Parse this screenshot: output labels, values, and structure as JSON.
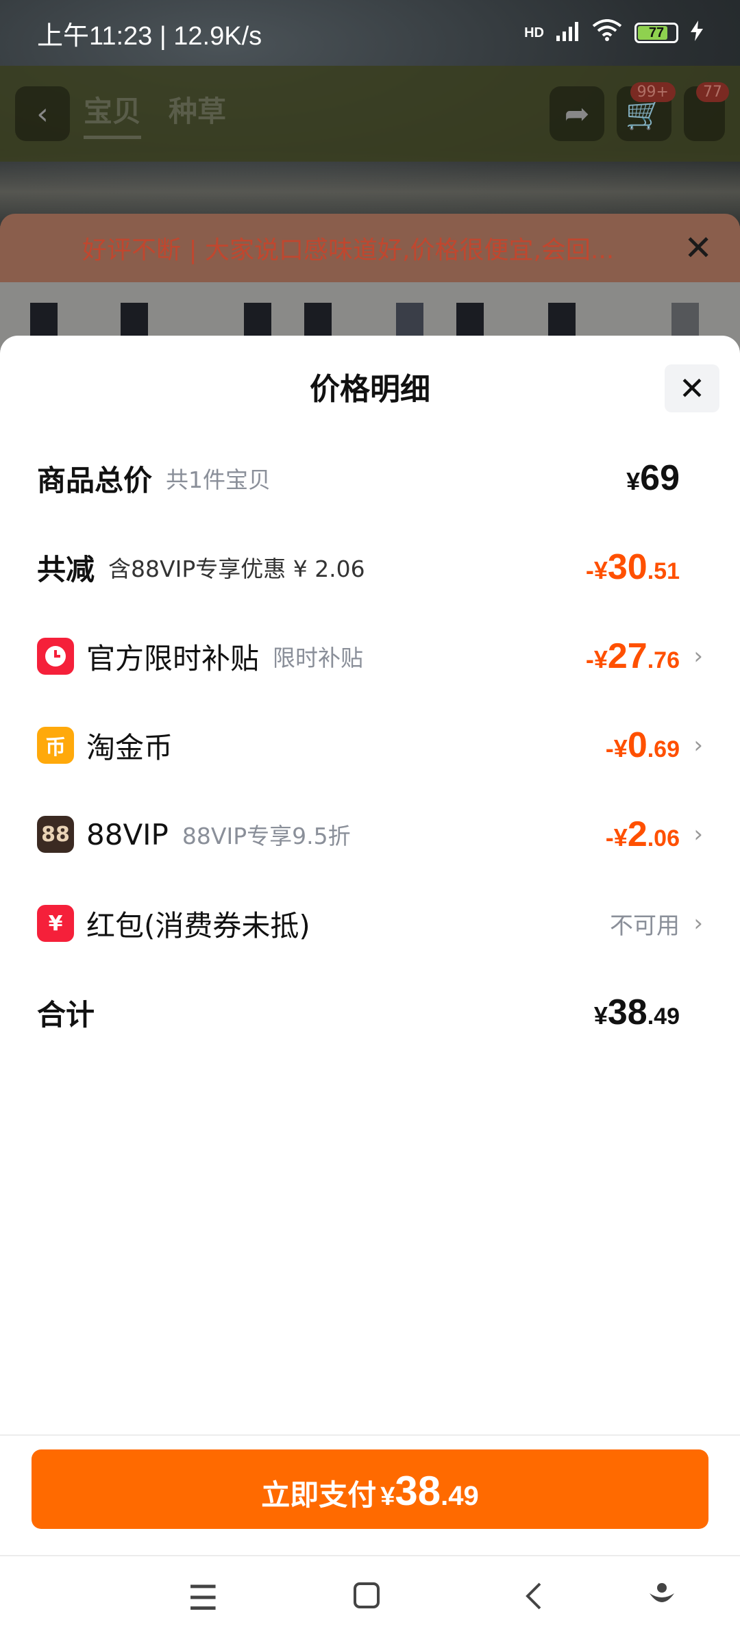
{
  "status_bar": {
    "time": "上午11:23 | 12.9K/s",
    "network": "HD",
    "battery": "77"
  },
  "nav": {
    "tabs": [
      "宝贝",
      "种草"
    ],
    "cart_badge": "99+",
    "message_badge": "77"
  },
  "promo": {
    "text": "好评不断 | 大家说口感味道好,价格很便宜,会回..."
  },
  "sheet": {
    "title": "价格明细",
    "rows": {
      "total": {
        "label": "商品总价",
        "sub": "共1件宝贝",
        "sym": "¥",
        "int": "69",
        "dec": ""
      },
      "reduce": {
        "label": "共减",
        "sub": "含88VIP专享优惠 ¥ 2.06",
        "sym": "-¥",
        "int": "30",
        "dec": ".51"
      },
      "subsidy": {
        "label": "官方限时补贴",
        "sub": "限时补贴",
        "sym": "-¥",
        "int": "27",
        "dec": ".76"
      },
      "coin": {
        "label": "淘金币",
        "sym": "-¥",
        "int": "0",
        "dec": ".69"
      },
      "vip": {
        "icon_text": "88",
        "label": "88VIP",
        "sub": "88VIP专享9.5折",
        "sym": "-¥",
        "int": "2",
        "dec": ".06"
      },
      "redpacket": {
        "label": "红包(消费券未抵)",
        "status": "不可用"
      },
      "sum": {
        "label": "合计",
        "sym": "¥",
        "int": "38",
        "dec": ".49"
      }
    }
  },
  "footer": {
    "pay_label": "立即支付",
    "sym": "¥",
    "int": "38",
    "dec": ".49"
  },
  "colors": {
    "accent": "#ff5000",
    "button": "#ff6a00"
  }
}
